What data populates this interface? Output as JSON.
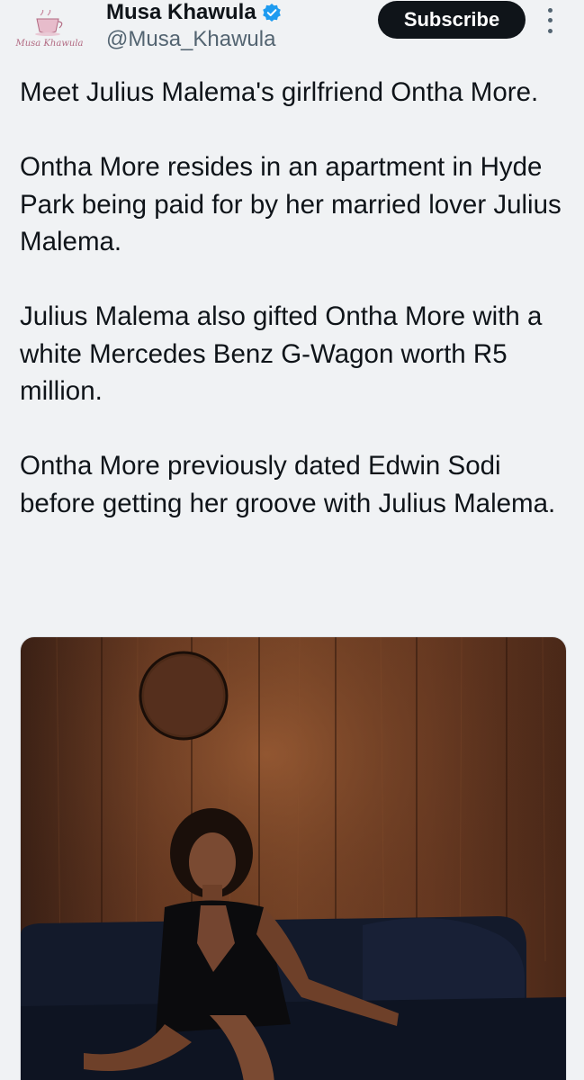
{
  "header": {
    "avatar_label": "Musa Khawula",
    "display_name": "Musa Khawula",
    "handle": "@Musa_Khawula",
    "verified": true,
    "subscribe_label": "Subscribe",
    "more_icon": "more-vertical-icon"
  },
  "tweet": {
    "paragraphs": [
      "Meet Julius Malema's girlfriend Ontha More.",
      "Ontha More resides in an apartment in Hyde Park being paid for by her married lover Julius Malema.",
      "Julius Malema also gifted Ontha More with a white Mercedes Benz G-Wagon worth R5 million.",
      "Ontha More previously dated Edwin Sodi before getting her groove with Julius Malema."
    ]
  },
  "media": {
    "type": "photo",
    "alt": ""
  },
  "colors": {
    "background": "#f0f2f4",
    "text_primary": "#0f1419",
    "text_secondary": "#536471",
    "verified": "#1d9bf0",
    "subscribe_bg": "#0f1419",
    "subscribe_text": "#ffffff"
  }
}
